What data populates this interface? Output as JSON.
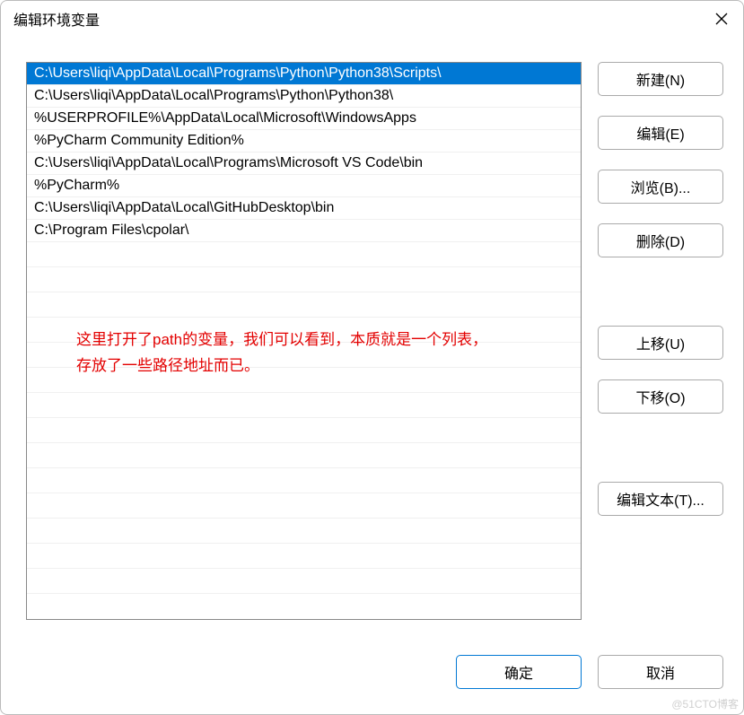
{
  "window": {
    "title": "编辑环境变量"
  },
  "paths": [
    {
      "value": "C:\\Users\\liqi\\AppData\\Local\\Programs\\Python\\Python38\\Scripts\\",
      "selected": true
    },
    {
      "value": "C:\\Users\\liqi\\AppData\\Local\\Programs\\Python\\Python38\\",
      "selected": false
    },
    {
      "value": "%USERPROFILE%\\AppData\\Local\\Microsoft\\WindowsApps",
      "selected": false
    },
    {
      "value": "%PyCharm Community Edition%",
      "selected": false
    },
    {
      "value": "C:\\Users\\liqi\\AppData\\Local\\Programs\\Microsoft VS Code\\bin",
      "selected": false
    },
    {
      "value": "%PyCharm%",
      "selected": false
    },
    {
      "value": "C:\\Users\\liqi\\AppData\\Local\\GitHubDesktop\\bin",
      "selected": false
    },
    {
      "value": "C:\\Program Files\\cpolar\\",
      "selected": false
    }
  ],
  "annotation": {
    "line1": "这里打开了path的变量，我们可以看到，本质就是一个列表，",
    "line2": "存放了一些路径地址而已。"
  },
  "buttons": {
    "new": "新建(N)",
    "edit": "编辑(E)",
    "browse": "浏览(B)...",
    "delete": "删除(D)",
    "move_up": "上移(U)",
    "move_down": "下移(O)",
    "edit_text": "编辑文本(T)...",
    "ok": "确定",
    "cancel": "取消"
  },
  "watermark": "@51CTO博客"
}
